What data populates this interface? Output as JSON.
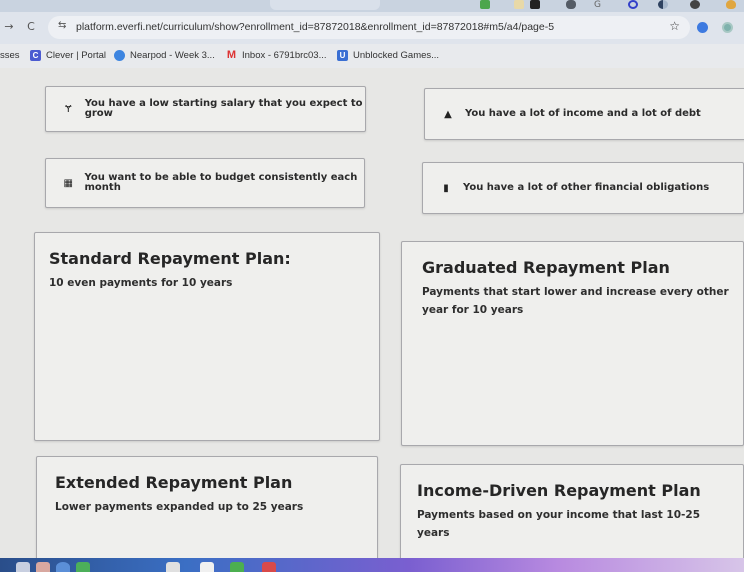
{
  "browser": {
    "extensions": [
      {
        "icon": "extension-icon-green"
      },
      {
        "icon": "extension-icon-search"
      },
      {
        "icon": "extension-icon-w"
      },
      {
        "icon": "extension-icon-shield"
      },
      {
        "icon": "extension-icon-g"
      },
      {
        "icon": "extension-icon-q"
      },
      {
        "icon": "extension-icon-half-circle"
      },
      {
        "icon": "extension-icon-chrome"
      },
      {
        "icon": "extension-icon-ear"
      }
    ],
    "back_glyph": "→",
    "reload_glyph": "C",
    "tune_glyph": "⇆",
    "url": "platform.everfi.net/curriculum/show?enrollment_id=87872018&enrollment_id=87872018#m5/a4/page-5",
    "star_glyph": "☆",
    "bookmarks": [
      {
        "label": "sses",
        "icon": ""
      },
      {
        "label": "Clever | Portal",
        "icon": "C"
      },
      {
        "label": "Nearpod - Week 3...",
        "icon": "◉"
      },
      {
        "label": "Inbox - 6791brc03...",
        "icon": "M"
      },
      {
        "label": "Unblocked Games...",
        "icon": "U"
      }
    ]
  },
  "scenarios": [
    {
      "icon": "sprout-icon",
      "glyph": "Ɏ",
      "text": "You have a low starting salary that you expect to grow"
    },
    {
      "icon": "warning-icon",
      "glyph": "▲",
      "text": "You have a lot of income and a lot of debt"
    },
    {
      "icon": "calendar-icon",
      "glyph": "▦",
      "text": "You want to be able to budget consistently each month"
    },
    {
      "icon": "document-icon",
      "glyph": "▮",
      "text": "You have a lot of other financial obligations"
    }
  ],
  "plans": [
    {
      "title": "Standard Repayment Plan:",
      "description": "10 even payments for 10 years"
    },
    {
      "title": "Graduated Repayment Plan",
      "description": "Payments that start lower and increase every other year for 10 years"
    },
    {
      "title": "Extended Repayment Plan",
      "description": "Lower payments expanded up to 25 years"
    },
    {
      "title": "Income-Driven Repayment Plan",
      "description": "Payments based on your income that last 10-25 years"
    }
  ]
}
